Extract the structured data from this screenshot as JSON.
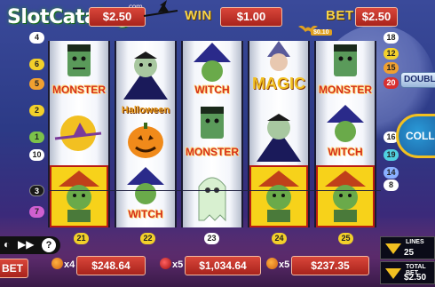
{
  "logo": {
    "text": "SlotCatalog",
    "suffix": "com"
  },
  "header": {
    "lines_label": "LINES",
    "lines_value": "$2.50",
    "win_label": "WIN",
    "win_value": "$1.00",
    "bet_label": "BET",
    "bet_value": "$2.50",
    "bat_value": "$0.10"
  },
  "reels": [
    {
      "symbols": [
        {
          "name": "Frankenstein",
          "label": "MONSTER"
        },
        {
          "name": "Witch on broom",
          "label": ""
        },
        {
          "name": "Witch",
          "label": "",
          "win": true
        }
      ]
    },
    {
      "symbols": [
        {
          "name": "Dracula",
          "label": ""
        },
        {
          "name": "Pumpkin",
          "label": "Halloween"
        },
        {
          "name": "Witch",
          "label": "WITCH"
        }
      ]
    },
    {
      "symbols": [
        {
          "name": "Witch",
          "label": "WITCH"
        },
        {
          "name": "Frankenstein",
          "label": "MONSTER"
        },
        {
          "name": "Ghost",
          "label": ""
        }
      ]
    },
    {
      "symbols": [
        {
          "name": "Wizard",
          "label": "MAGIC"
        },
        {
          "name": "Dracula",
          "label": ""
        },
        {
          "name": "Witch",
          "label": "",
          "win": true
        }
      ]
    },
    {
      "symbols": [
        {
          "name": "Frankenstein",
          "label": "MONSTER"
        },
        {
          "name": "Witch",
          "label": "WITCH"
        },
        {
          "name": "Witch",
          "label": "",
          "win": true
        }
      ]
    }
  ],
  "markers_left": [
    "4",
    "6",
    "5",
    "2",
    "1",
    "10",
    "3",
    "7"
  ],
  "markers_right": [
    "18",
    "12",
    "15",
    "20",
    "16",
    "19",
    "14",
    "8"
  ],
  "markers_bottom": [
    "21",
    "22",
    "23",
    "24",
    "25"
  ],
  "buttons": {
    "double": "DOUBLE",
    "collect": "COLL",
    "bet": "BET",
    "help": "?"
  },
  "bottom": {
    "prize1_mult": "x4",
    "prize1": "$248.64",
    "prize2_mult": "x5",
    "prize2": "$1,034.64",
    "prize3_mult": "x5",
    "prize3": "$237.35"
  },
  "right_panel": {
    "lines_label": "LINES",
    "lines_value": "25",
    "total_bet_label": "TOTAL BET",
    "total_bet_value": "$2.50"
  },
  "colors": {
    "accent_red": "#c0302a",
    "gold": "#f2c021",
    "win_frame": "#f7d21a"
  }
}
